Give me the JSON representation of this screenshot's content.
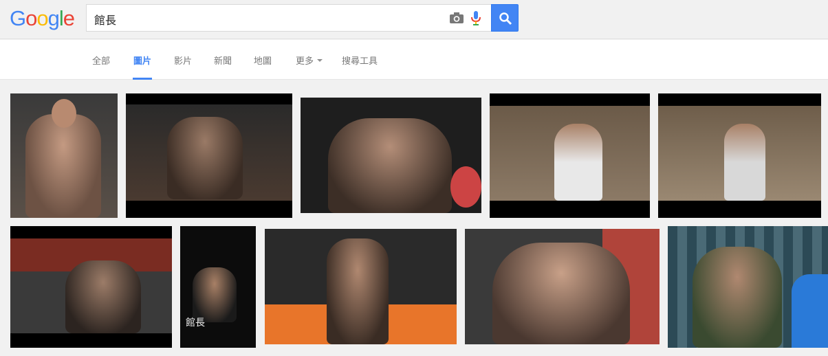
{
  "logo": {
    "text": "Google",
    "letters": [
      {
        "ch": "G",
        "color": "#4285f4"
      },
      {
        "ch": "o",
        "color": "#ea4335"
      },
      {
        "ch": "o",
        "color": "#fbbc05"
      },
      {
        "ch": "g",
        "color": "#4285f4"
      },
      {
        "ch": "l",
        "color": "#34a853"
      },
      {
        "ch": "e",
        "color": "#ea4335"
      }
    ]
  },
  "search": {
    "query": "館長",
    "camera_icon": "camera-icon",
    "mic_icon": "mic-icon",
    "search_icon": "search-icon"
  },
  "nav": {
    "tabs": [
      {
        "label": "全部"
      },
      {
        "label": "圖片",
        "active": true
      },
      {
        "label": "影片"
      },
      {
        "label": "新聞"
      },
      {
        "label": "地圖"
      },
      {
        "label": "更多"
      },
      {
        "label": "搜尋工具"
      }
    ]
  },
  "colors": {
    "accent": "#4285f4",
    "tab_text": "#777777"
  },
  "images": {
    "count": 11,
    "poster_caption": "館長"
  }
}
